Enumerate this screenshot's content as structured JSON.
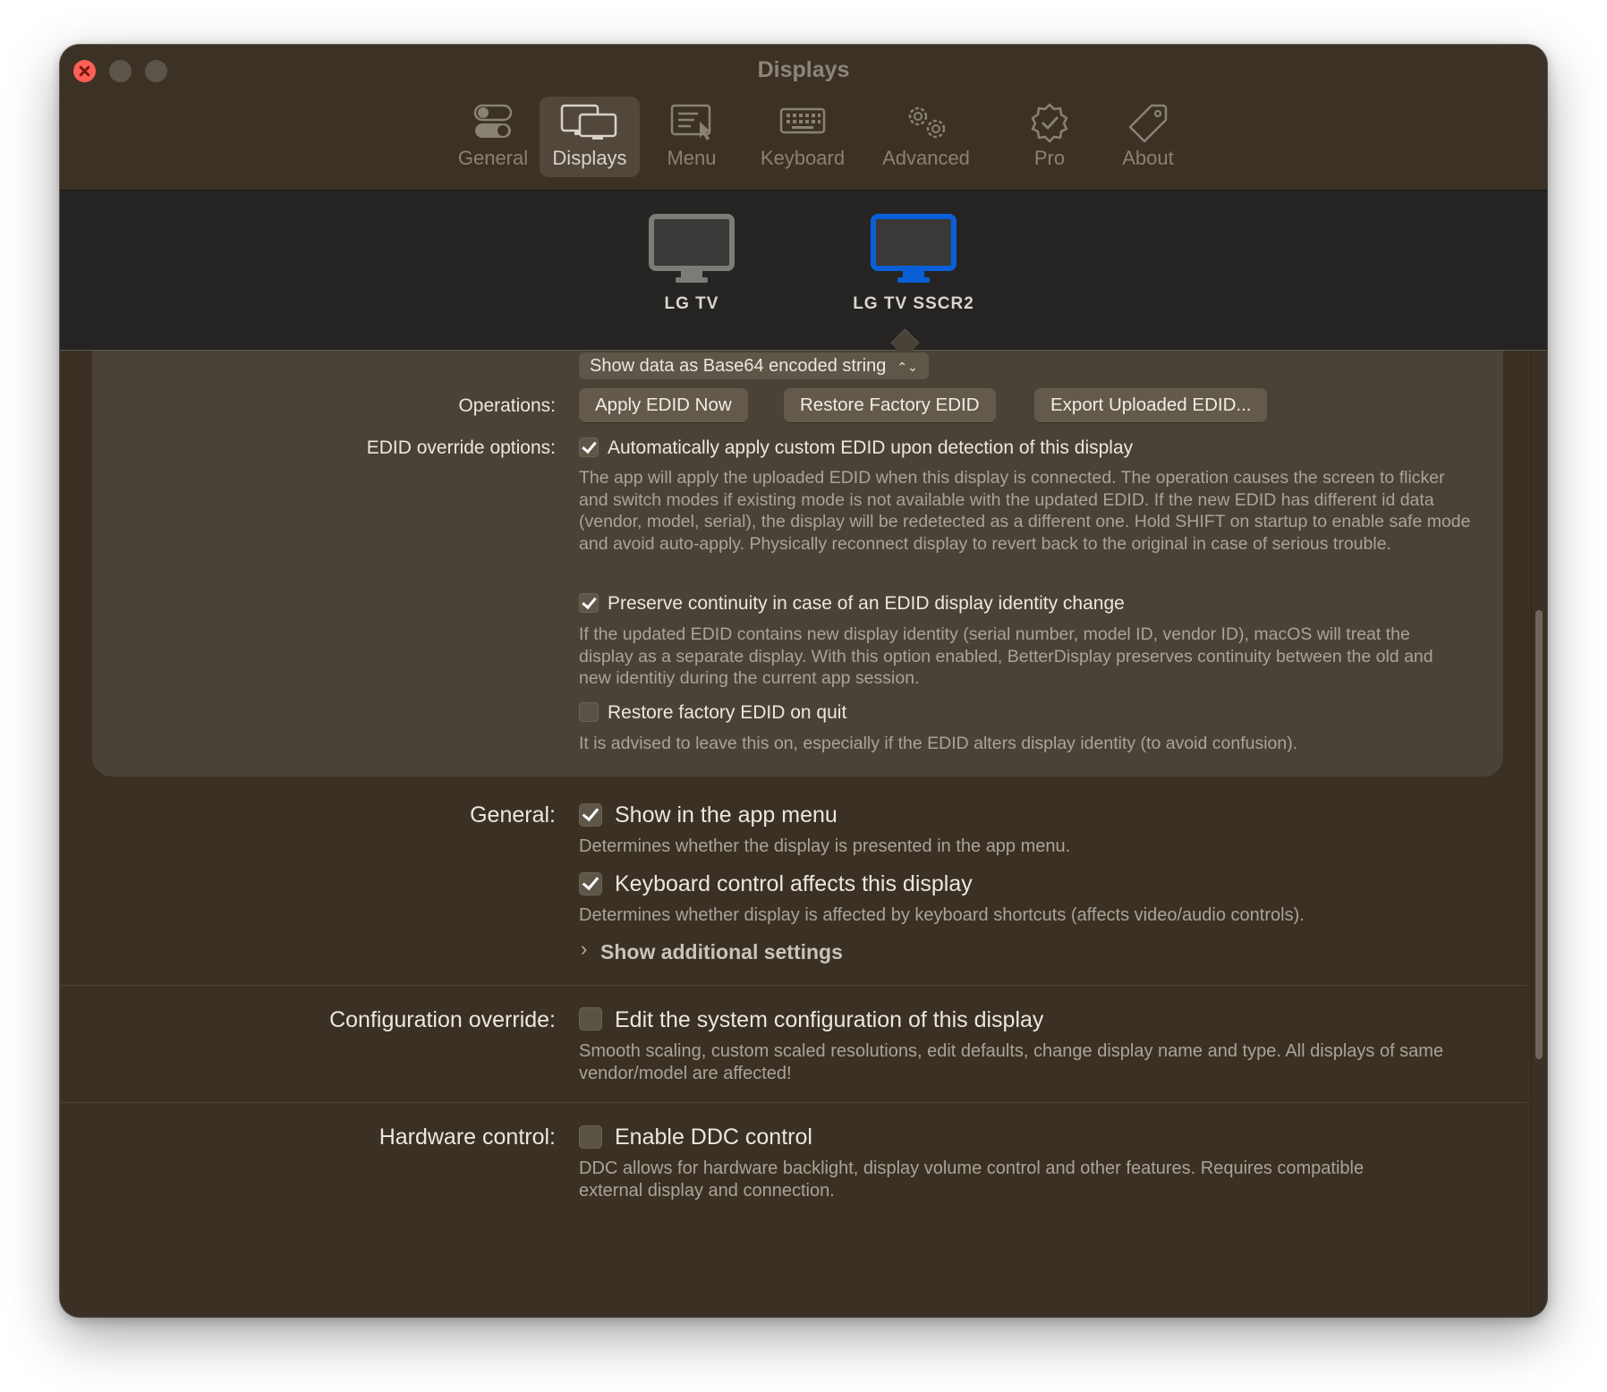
{
  "window": {
    "title": "Displays"
  },
  "toolbar": {
    "tabs": [
      {
        "label": "General",
        "icon": "toggles-icon"
      },
      {
        "label": "Displays",
        "icon": "displays-icon",
        "active": true
      },
      {
        "label": "Menu",
        "icon": "menu-icon"
      },
      {
        "label": "Keyboard",
        "icon": "keyboard-icon"
      },
      {
        "label": "Advanced",
        "icon": "gears-icon"
      },
      {
        "label": "Pro",
        "icon": "seal-check-icon"
      },
      {
        "label": "About",
        "icon": "tag-icon"
      }
    ]
  },
  "displays": [
    {
      "name": "LG TV",
      "selected": false
    },
    {
      "name": "LG TV SSCR2",
      "selected": true
    }
  ],
  "edid": {
    "data_format": "Show data as Base64 encoded string",
    "operations_label": "Operations:",
    "operations": [
      "Apply EDID Now",
      "Restore Factory EDID",
      "Export Uploaded EDID..."
    ],
    "override_label": "EDID override options:",
    "options": [
      {
        "label": "Automatically apply custom EDID upon detection of this display",
        "checked": true,
        "desc": "The app will apply the uploaded EDID when this display is connected. The operation causes the screen to flicker and switch modes if existing mode is not available with the updated EDID. If the new EDID has different id data (vendor, model, serial), the display will be redetected as a different one. Hold SHIFT on startup to enable safe mode and avoid auto-apply. Physically reconnect  display to revert back to the original in case of serious trouble."
      },
      {
        "label": "Preserve continuity in case of an EDID display identity change",
        "checked": true,
        "desc": "If the updated EDID contains new display identity (serial number, model ID, vendor ID), macOS will treat the display as a separate display. With this option enabled, BetterDisplay preserves continuity between the old and new identitiy during the current app session."
      },
      {
        "label": "Restore factory EDID on quit",
        "checked": false,
        "desc": "It is advised to leave this on, especially if the EDID alters display identity (to avoid confusion)."
      }
    ]
  },
  "general": {
    "label": "General:",
    "options": [
      {
        "label": "Show in the app menu",
        "checked": true,
        "desc": "Determines whether the display is presented in the app menu."
      },
      {
        "label": "Keyboard control affects this display",
        "checked": true,
        "desc": "Determines whether display is affected by keyboard shortcuts (affects video/audio controls)."
      }
    ],
    "additional": "Show additional settings"
  },
  "config_override": {
    "label": "Configuration override:",
    "option": "Edit the system configuration of this display",
    "checked": false,
    "desc": "Smooth scaling, custom scaled resolutions, edit defaults, change display name and type. All displays of same vendor/model are affected!"
  },
  "hardware_control": {
    "label": "Hardware control:",
    "option": "Enable DDC control",
    "checked": false,
    "desc": "DDC allows for hardware backlight, display volume control and other features. Requires compatible external display and connection."
  },
  "colors": {
    "window_bg": "#3a3124",
    "panel_bg": "#4a4236",
    "picker_bg": "#252422",
    "accent": "#0a5fd6",
    "close_button": "#fe5f57"
  }
}
